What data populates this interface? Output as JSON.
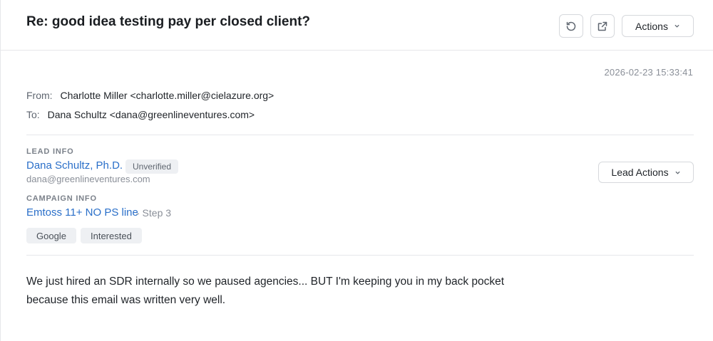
{
  "email": {
    "subject": "Re: good idea testing pay per closed client?",
    "timestamp": "2026-02-23 15:33:41",
    "from_label": "From:",
    "from_value": "Charlotte Miller <charlotte.miller@cielazure.org>",
    "to_label": "To:",
    "to_value": "Dana Schultz <dana@greenlineventures.com>",
    "body_line1": "We just hired an SDR internally so we paused agencies... BUT I'm keeping you in my back pocket",
    "body_line2": "because this email was written very well."
  },
  "toolbar": {
    "refresh_icon": "refresh-icon",
    "open_external_icon": "external-link-icon",
    "actions_label": "Actions"
  },
  "lead": {
    "section_label": "LEAD INFO",
    "name": "Dana Schultz, Ph.D.",
    "status_badge": "Unverified",
    "email": "dana@greenlineventures.com",
    "actions_label": "Lead Actions"
  },
  "campaign": {
    "section_label": "CAMPAIGN INFO",
    "name": "Emtoss 11+ NO PS line",
    "step": "- Step 3",
    "tags": [
      "Google",
      "Interested"
    ]
  },
  "colors": {
    "link": "#2a6fc9",
    "muted": "#8a8f98",
    "border": "#d6d8dc",
    "tag_bg": "#eef0f3"
  }
}
